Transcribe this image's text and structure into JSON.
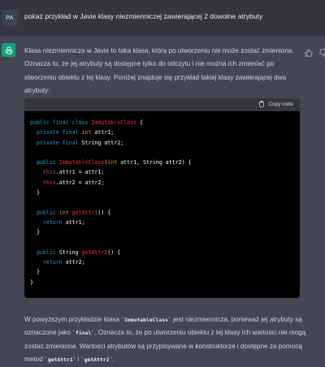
{
  "user_message": {
    "avatar_initials": "PA",
    "text": "pokaż przykład w Javie klasy niezmienniczej zawierającej 2 dowolne atrybuty"
  },
  "assistant_message": {
    "avatar_icon": "openai-logo-icon",
    "feedback_icons": [
      "thumbs-up-icon",
      "thumbs-down-icon"
    ],
    "intro": "Klasa niezmiennicza w Javie to taka klasa, która po utworzeniu nie może zostać zmieniona. Oznacza to, że jej atrybuty są dostępne tylko do odczytu i nie można ich zmieniać po stworzeniu obiektu z tej klasy. Poniżej znajduje się przykład takiej klasy zawierającej dwa atrybuty:",
    "code_block": {
      "copy_label": "Copy code",
      "lines": [
        [
          [
            "kw",
            "public final class "
          ],
          [
            "nm",
            "ImmutableClass"
          ],
          [
            "tx",
            " {"
          ]
        ],
        [
          [
            "tx",
            "  "
          ],
          [
            "kw",
            "private final "
          ],
          [
            "ty",
            "int"
          ],
          [
            "tx",
            " attr1;"
          ]
        ],
        [
          [
            "tx",
            "  "
          ],
          [
            "kw",
            "private final "
          ],
          [
            "tx",
            "String attr2;"
          ]
        ],
        [
          [
            "tx",
            ""
          ]
        ],
        [
          [
            "tx",
            "  "
          ],
          [
            "kw",
            "public "
          ],
          [
            "nm",
            "ImmutableClass"
          ],
          [
            "tx",
            "("
          ],
          [
            "ty",
            "int"
          ],
          [
            "tx",
            " attr1, String attr2) {"
          ]
        ],
        [
          [
            "tx",
            "    "
          ],
          [
            "th",
            "this"
          ],
          [
            "tx",
            ".attr1 = attr1;"
          ]
        ],
        [
          [
            "tx",
            "    "
          ],
          [
            "th",
            "this"
          ],
          [
            "tx",
            ".attr2 = attr2;"
          ]
        ],
        [
          [
            "tx",
            "  }"
          ]
        ],
        [
          [
            "tx",
            ""
          ]
        ],
        [
          [
            "tx",
            "  "
          ],
          [
            "kw",
            "public "
          ],
          [
            "ty",
            "int"
          ],
          [
            "tx",
            " "
          ],
          [
            "nm",
            "getAttr1"
          ],
          [
            "tx",
            "() {"
          ]
        ],
        [
          [
            "tx",
            "    "
          ],
          [
            "kw",
            "return"
          ],
          [
            "tx",
            " attr1;"
          ]
        ],
        [
          [
            "tx",
            "  }"
          ]
        ],
        [
          [
            "tx",
            ""
          ]
        ],
        [
          [
            "tx",
            "  "
          ],
          [
            "kw",
            "public "
          ],
          [
            "tx",
            "String "
          ],
          [
            "nm",
            "getAttr2"
          ],
          [
            "tx",
            "() {"
          ]
        ],
        [
          [
            "tx",
            "    "
          ],
          [
            "kw",
            "return"
          ],
          [
            "tx",
            " attr2;"
          ]
        ],
        [
          [
            "tx",
            "  }"
          ]
        ],
        [
          [
            "tx",
            "}"
          ]
        ]
      ]
    },
    "outro": {
      "t1": "W powyższym przykładzie klasa ",
      "c1": "`ImmutableClass`",
      "t2": " jest niezmiennicza, ponieważ jej atrybuty są oznaczone jako ",
      "c2": "`final`",
      "t3": ". Oznacza to, że po utworzeniu obiektu z tej klasy ich wartości nie mogą zostać zmienione. Wartości atrybutów są przypisywane w konstruktorze i dostępne za pomocą metod ",
      "c3": "`getAttr1`",
      "t4": " i ",
      "c4": "`getAttr2`",
      "t5": "."
    }
  },
  "colors": {
    "user_bg": "#343541",
    "assistant_bg": "#444654",
    "brand_green": "#10a37f",
    "code_bg": "#000000",
    "code_header_bg": "#343541"
  }
}
